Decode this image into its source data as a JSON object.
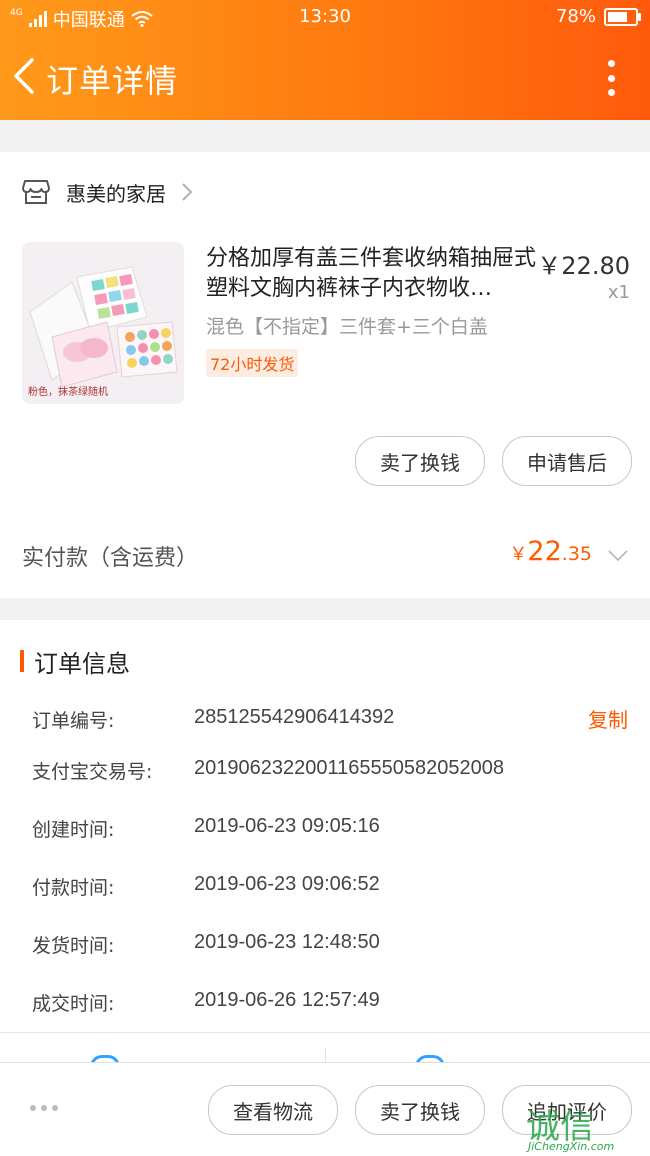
{
  "status_bar": {
    "carrier": "中国联通",
    "network": "4G",
    "time": "13:30",
    "battery": "78%",
    "battery_level": 0.78
  },
  "nav": {
    "title": "订单详情"
  },
  "shop": {
    "name": "惠美的家居"
  },
  "product": {
    "title": "分格加厚有盖三件套收纳箱抽屉式塑料文胸内裤袜子内衣物收…",
    "price": "￥22.80",
    "quantity": "x1",
    "spec": "混色【不指定】三件套+三个白盖",
    "tag": "72小时发货",
    "image_caption": "粉色，抹茶绿随机",
    "actions": {
      "sell": "卖了换钱",
      "after_sale": "申请售后"
    }
  },
  "payment": {
    "label": "实付款（含运费）",
    "currency": "￥",
    "amount_int": "22",
    "amount_dec": ".35"
  },
  "order_info": {
    "title": "订单信息",
    "copy_label": "复制",
    "rows": [
      {
        "label": "订单编号:",
        "value": "285125542906414392"
      },
      {
        "label": "支付宝交易号:",
        "value": "2019062322001165550582052008"
      },
      {
        "label": "创建时间:",
        "value": "2019-06-23 09:05:16"
      },
      {
        "label": "付款时间:",
        "value": "2019-06-23 09:06:52"
      },
      {
        "label": "发货时间:",
        "value": "2019-06-23 12:48:50"
      },
      {
        "label": "成交时间:",
        "value": "2019-06-26 12:57:49"
      }
    ]
  },
  "bottom_bar": {
    "logistics": "查看物流",
    "sell": "卖了换钱",
    "review": "追加评价"
  },
  "watermark": {
    "logo": "诚信",
    "site": "JiChengXin.com"
  },
  "colors": {
    "accent": "#ff5a00",
    "header_start": "#ff9a1a",
    "header_end": "#ff5a0c"
  }
}
